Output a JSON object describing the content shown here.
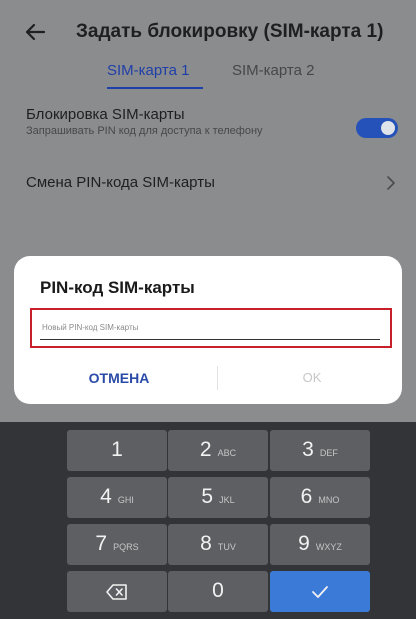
{
  "header": {
    "title": "Задать блокировку (SIM-карта 1)"
  },
  "tabs": [
    {
      "label": "SIM-карта 1",
      "selected": true
    },
    {
      "label": "SIM-карта 2",
      "selected": false
    }
  ],
  "settings": {
    "sim_lock": {
      "title": "Блокировка SIM-карты",
      "description": "Запрашивать PIN код для доступа к телефону",
      "enabled": true
    },
    "change_pin": {
      "label": "Смена PIN-кода SIM-карты"
    }
  },
  "dialog": {
    "title": "PIN-код SIM-карты",
    "input_placeholder": "Новый PIN-код SIM-карты",
    "input_value": "",
    "cancel_label": "ОТМЕНА",
    "ok_label": "OK"
  },
  "keypad": {
    "keys": [
      {
        "digit": "1",
        "letters": ""
      },
      {
        "digit": "2",
        "letters": "ABC"
      },
      {
        "digit": "3",
        "letters": "DEF"
      },
      {
        "digit": "4",
        "letters": "GHI"
      },
      {
        "digit": "5",
        "letters": "JKL"
      },
      {
        "digit": "6",
        "letters": "MNO"
      },
      {
        "digit": "7",
        "letters": "PQRS"
      },
      {
        "digit": "8",
        "letters": "TUV"
      },
      {
        "digit": "9",
        "letters": "WXYZ"
      },
      {
        "digit": "0",
        "letters": ""
      }
    ],
    "backspace_icon": "backspace-icon",
    "confirm_icon": "checkmark-icon"
  },
  "colors": {
    "accent": "#2552b8",
    "dialog_highlight": "#c8202a",
    "confirm_key": "#3c7ad8",
    "key_bg": "#5e5f63",
    "keypad_bg": "#333437"
  }
}
